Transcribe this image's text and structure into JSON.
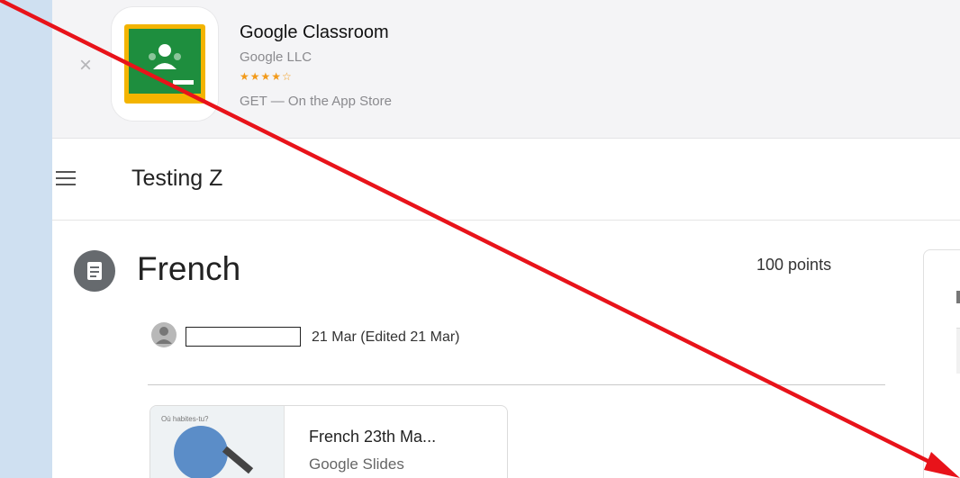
{
  "banner": {
    "app_title": "Google Classroom",
    "developer": "Google LLC",
    "rating_stars": "★★★★☆",
    "get_text": "GET — On the App Store",
    "close_icon": "×"
  },
  "header": {
    "class_name": "Testing Z"
  },
  "assignment": {
    "title": "French",
    "points": "100 points",
    "date": "21 Mar (Edited 21 Mar)"
  },
  "attachment": {
    "title": "French 23th Ma...",
    "type": "Google Slides",
    "thumb_text": "Où habites-tu?"
  },
  "annotation": {
    "arrow_color": "#e8131a"
  }
}
